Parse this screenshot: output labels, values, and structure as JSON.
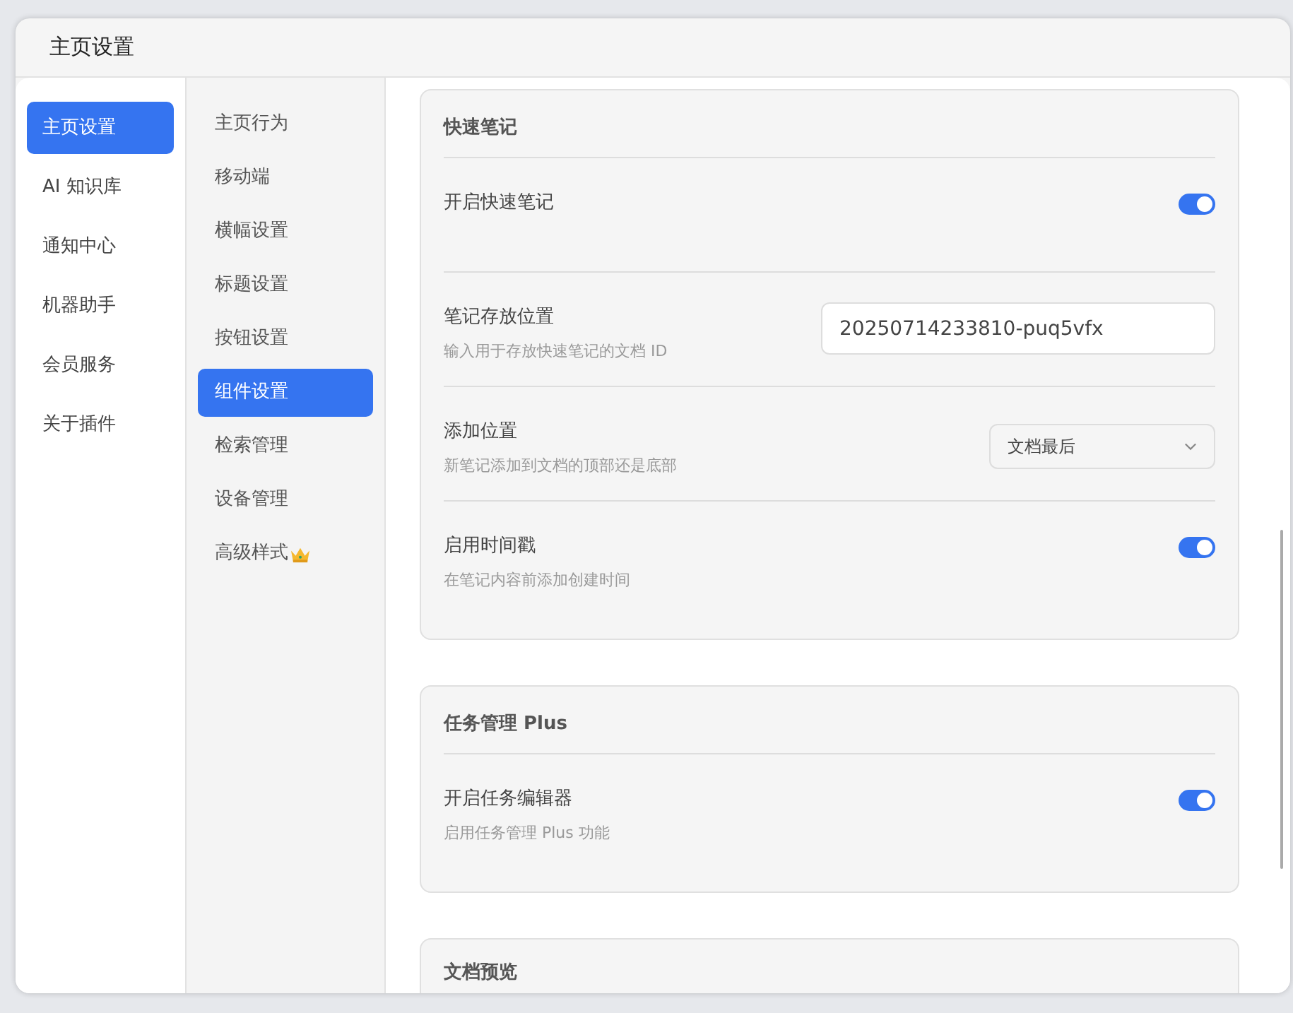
{
  "window": {
    "title": "主页设置"
  },
  "nav": [
    {
      "label": "主页设置",
      "selected": true
    },
    {
      "label": "AI 知识库",
      "selected": false
    },
    {
      "label": "通知中心",
      "selected": false
    },
    {
      "label": "机器助手",
      "selected": false
    },
    {
      "label": "会员服务",
      "selected": false
    },
    {
      "label": "关于插件",
      "selected": false
    }
  ],
  "subnav": [
    {
      "label": "主页行为",
      "selected": false
    },
    {
      "label": "移动端",
      "selected": false
    },
    {
      "label": "横幅设置",
      "selected": false
    },
    {
      "label": "标题设置",
      "selected": false
    },
    {
      "label": "按钮设置",
      "selected": false
    },
    {
      "label": "组件设置",
      "selected": true
    },
    {
      "label": "检索管理",
      "selected": false
    },
    {
      "label": "设备管理",
      "selected": false
    },
    {
      "label": "高级样式",
      "selected": false,
      "kind": "premium"
    }
  ],
  "sections": [
    {
      "title": "快速笔记",
      "rows": [
        {
          "kind": "toggle",
          "label": "开启快速笔记",
          "on": true
        },
        {
          "kind": "input",
          "label": "笔记存放位置",
          "description": "输入用于存放快速笔记的文档 ID",
          "value": "20250714233810-puq5vfx"
        },
        {
          "kind": "select",
          "label": "添加位置",
          "description": "新笔记添加到文档的顶部还是底部",
          "value": "文档最后"
        },
        {
          "kind": "toggle",
          "label": "启用时间戳",
          "description": "在笔记内容前添加创建时间",
          "on": true
        }
      ]
    },
    {
      "title": "任务管理 Plus",
      "rows": [
        {
          "kind": "toggle",
          "label": "开启任务编辑器",
          "description": "启用任务管理 Plus 功能",
          "on": true
        }
      ]
    },
    {
      "title": "文档预览"
    }
  ]
}
